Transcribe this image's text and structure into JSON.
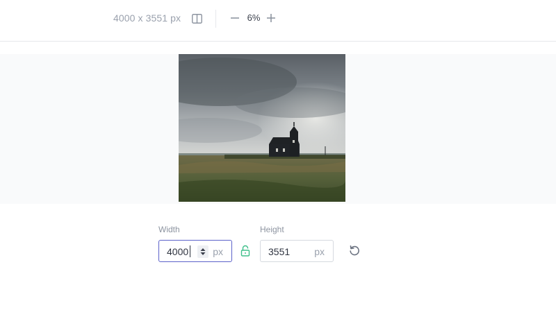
{
  "toolbar": {
    "dimensions_text": "4000 x 3551 px",
    "compare_icon": "split-view-icon",
    "zoom_out_icon": "minus-icon",
    "zoom_level": "6%",
    "zoom_in_icon": "plus-icon"
  },
  "preview": {
    "image_description": "lonely black church under stormy sky on grassy field"
  },
  "resize": {
    "width": {
      "label": "Width",
      "value": "4000",
      "unit": "px"
    },
    "height": {
      "label": "Height",
      "value": "3551",
      "unit": "px"
    },
    "lock_icon": "unlocked-padlock-icon",
    "reset_icon": "reset-icon"
  },
  "colors": {
    "accent_focus": "#5b61c9",
    "lock_green": "#3fbf8a",
    "muted_text": "#9aa1ad"
  }
}
